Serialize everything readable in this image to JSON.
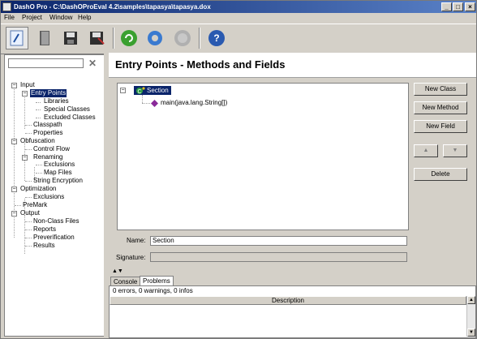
{
  "window": {
    "title": "DashO Pro - C:\\DashOProEval 4.2\\samples\\tapasya\\tapasya.dox"
  },
  "menu": [
    "File",
    "Project",
    "Window",
    "Help"
  ],
  "toolbar": {
    "buttons": [
      "wizard-icon",
      "book-icon",
      "save-icon",
      "save-as-icon",
      "run-icon",
      "gear-icon",
      "stop-icon",
      "help-icon"
    ]
  },
  "tree": {
    "search_value": "",
    "nodes": [
      "Input",
      "Entry Points",
      "Libraries",
      "Special Classes",
      "Excluded Classes",
      "Classpath",
      "Properties",
      "Obfuscation",
      "Control Flow",
      "Renaming",
      "Exclusions",
      "Map Files",
      "String Encryption",
      "Optimization",
      "Exclusions",
      "PreMark",
      "Output",
      "Non-Class Files",
      "Reports",
      "Preverification",
      "Results"
    ]
  },
  "page": {
    "title": "Entry Points - Methods and Fields"
  },
  "entry_points": {
    "section_label": "Section",
    "method_label": "main(java.lang.String[])"
  },
  "buttons": {
    "new_class": "New Class",
    "new_method": "New Method",
    "new_field": "New Field",
    "up": "▲",
    "down": "▼",
    "delete": "Delete"
  },
  "form": {
    "name_label": "Name:",
    "name_value": "Section",
    "signature_label": "Signature:",
    "signature_value": ""
  },
  "bottom": {
    "tabs": [
      "Console",
      "Problems"
    ],
    "status": "0 errors, 0 warnings, 0 infos",
    "column": "Description"
  },
  "colors": {
    "selection": "#0a246a",
    "title_start": "#0a246a",
    "title_end": "#5a82c8"
  }
}
